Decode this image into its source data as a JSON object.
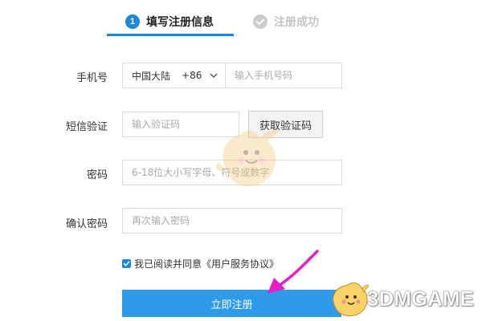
{
  "steps": [
    {
      "number": "1",
      "label": "填写注册信息",
      "active": true
    },
    {
      "label": "注册成功",
      "active": false
    }
  ],
  "form": {
    "phone": {
      "label": "手机号",
      "region": "中国大陆",
      "code": "+86",
      "placeholder": "输入手机号码"
    },
    "sms": {
      "label": "短信验证",
      "placeholder": "输入验证码",
      "button": "获取验证码"
    },
    "password": {
      "label": "密码",
      "placeholder": "6-18位大小写字母、符号或数字"
    },
    "confirm": {
      "label": "确认密码",
      "placeholder": "再次输入密码"
    },
    "agreement": {
      "text": "我已阅读并同意",
      "link": "《用户服务协议》",
      "checked": true
    },
    "submit": "立即注册"
  },
  "watermark": {
    "brand": "3DMGAME"
  },
  "colors": {
    "accent": "#1e88d8",
    "button": "#2d9bea",
    "arrow": "#e81ec6",
    "inactive": "#c4c4c4"
  },
  "icons": {
    "step_done": "check-circle-icon",
    "dropdown": "chevron-down-icon",
    "checkbox": "checkbox-checked-icon"
  }
}
